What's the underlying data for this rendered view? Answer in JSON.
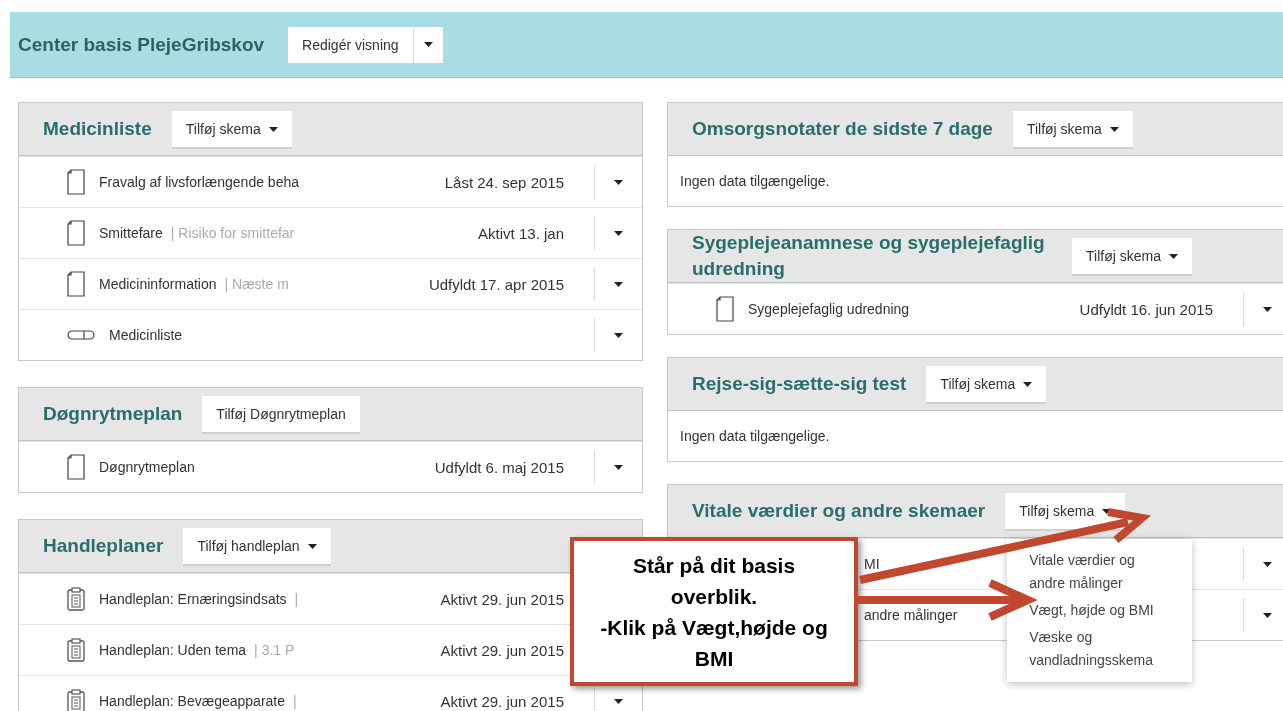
{
  "header": {
    "title": "Center basis PlejeGribskov",
    "button": "Redigér visning"
  },
  "columns": [
    [
      {
        "title": "Medicinliste",
        "button": {
          "label": "Tilføj skema",
          "caret": true
        },
        "rows": [
          {
            "kind": "document",
            "name": "Fravalg af livsforlængende beha",
            "status": "Låst 24. sep 2015"
          },
          {
            "kind": "document",
            "name": "Smittefare",
            "detail": "| Risiko for smittefar",
            "status": "Aktivt 13. jan"
          },
          {
            "kind": "document",
            "name": "Medicininformation",
            "detail": "| Næste m",
            "status": "Udfyldt 17. apr 2015"
          },
          {
            "kind": "pill",
            "name": "Medicinliste"
          }
        ]
      },
      {
        "title": "Døgnrytmeplan",
        "button": {
          "label": "Tilføj Døgnrytmeplan",
          "caret": false
        },
        "rows": [
          {
            "kind": "document",
            "name": "Døgnrytmeplan",
            "status": "Udfyldt 6. maj 2015"
          }
        ]
      },
      {
        "title": "Handleplaner",
        "button": {
          "label": "Tilføj handleplan",
          "caret": true
        },
        "rows": [
          {
            "kind": "clipboard",
            "name": "Handleplan: Ernæringsindsats",
            "detail": "|",
            "status": "Aktivt 29. jun 2015",
            "menu_hidden": true
          },
          {
            "kind": "clipboard",
            "name": "Handleplan: Uden tema",
            "detail": "| 3.1 P",
            "status": "Aktivt 29. jun 2015",
            "menu_hidden": true
          },
          {
            "kind": "clipboard",
            "name": "Handleplan: Bevægeapparate",
            "detail": "|",
            "status": "Aktivt 29. jun 2015"
          }
        ]
      }
    ],
    [
      {
        "title": "Omsorgsnotater de sidste 7 dage",
        "button": {
          "label": "Tilføj skema",
          "caret": true
        },
        "empty": "Ingen data tilgængelige."
      },
      {
        "title": "Sygeplejeanamnese og sygeplejefaglig udredning",
        "button": {
          "label": "Tilføj skema",
          "caret": true
        },
        "rows": [
          {
            "kind": "document",
            "name": "Sygeplejefaglig udredning",
            "status": "Udfyldt 16. jun 2015"
          }
        ]
      },
      {
        "title": "Rejse-sig-sætte-sig test",
        "button": {
          "label": "Tilføj skema",
          "caret": true
        },
        "empty": "Ingen data tilgængelige."
      },
      {
        "title": "Vitale værdier og andre skemaer",
        "button": {
          "label": "Tilføj skema",
          "caret": true
        },
        "menu": [
          "Vitale værdier og andre målinger",
          "Vægt, højde og BMI",
          "Væske og vandladningsskema"
        ],
        "rows": [
          {
            "kind": "covered",
            "name": "MI"
          },
          {
            "kind": "covered",
            "name": "andre målinger"
          }
        ]
      }
    ]
  ],
  "callout": [
    "Står på dit basis overblik.",
    "-Klik på Vægt,højde og BMI"
  ]
}
